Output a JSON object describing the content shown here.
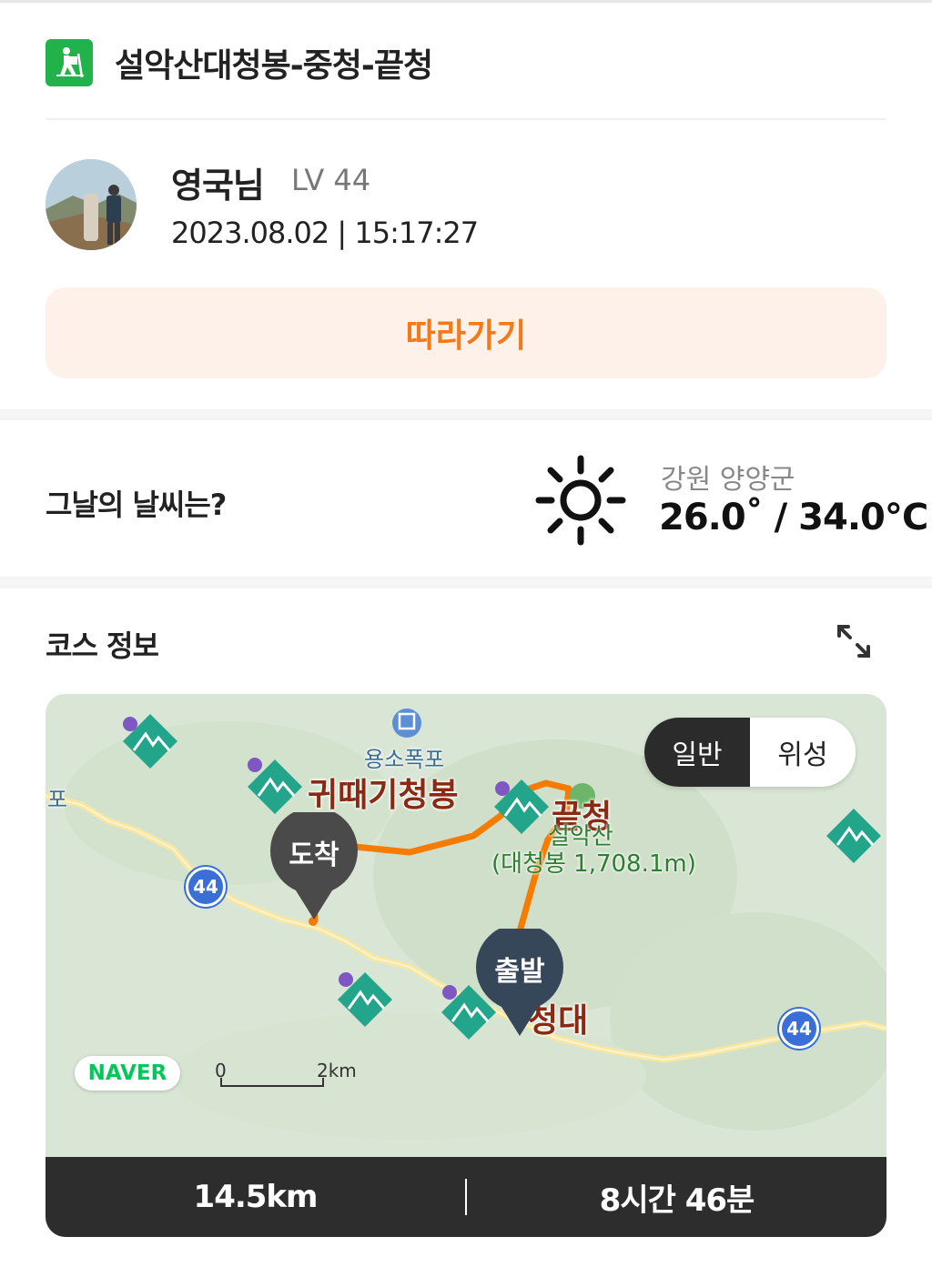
{
  "header": {
    "title": "설악산대청봉-중청-끝청",
    "icon": "hiker-icon",
    "accent_color": "#22b24c"
  },
  "user": {
    "name": "영국님",
    "level": "LV 44",
    "datetime": "2023.08.02 | 15:17:27"
  },
  "follow_button": {
    "label": "따라가기",
    "text_color": "#f27a1a",
    "bg_color": "#fdf1e9"
  },
  "weather": {
    "question": "그날의 날씨는?",
    "icon": "sun-icon",
    "region": "강원 양양군",
    "temperature": "26.0˚ / 34.0℃"
  },
  "course": {
    "title": "코스 정보",
    "expand_icon": "expand-icon",
    "map": {
      "toggle": {
        "normal": "일반",
        "satellite": "위성",
        "selected": "일반"
      },
      "labels": {
        "waterfall": "용소폭포",
        "peak_left": "귀때기청봉",
        "peak_right": "끝청",
        "mountain": "설악산",
        "summit": "(대청봉 1,708.1m)",
        "bottom_right": "청대",
        "edge_left": "포"
      },
      "pins": {
        "end": "도착",
        "start": "출발"
      },
      "route_numbers": [
        "44",
        "44"
      ],
      "brand": "NAVER",
      "scale": {
        "start": "0",
        "end": "2km"
      }
    },
    "stats": {
      "distance": "14.5km",
      "duration": "8시간 46분"
    }
  }
}
